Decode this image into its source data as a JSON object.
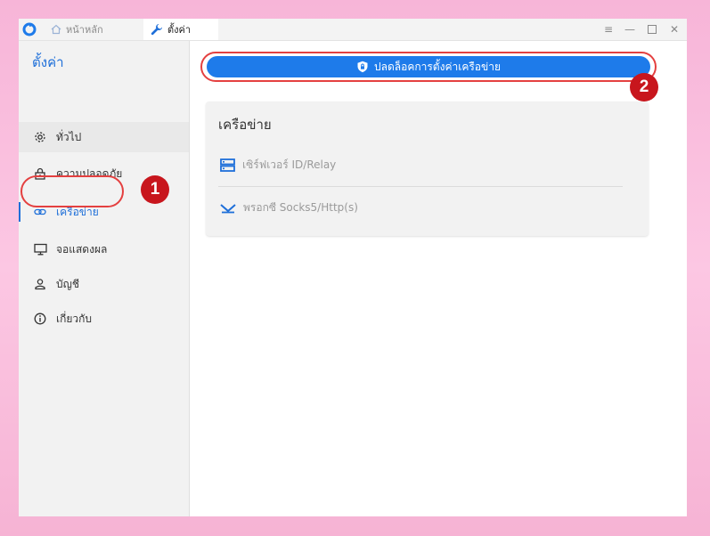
{
  "titlebar": {
    "tabs": [
      {
        "label": "หน้าหลัก",
        "icon": "home-icon"
      },
      {
        "label": "ตั้งค่า",
        "icon": "wrench-icon"
      }
    ],
    "controls": [
      "menu-icon",
      "minimize-icon",
      "maximize-icon",
      "close-icon"
    ]
  },
  "sidebar": {
    "title": "ตั้งค่า",
    "items": [
      {
        "label": "ทั่วไป",
        "icon": "gear-icon"
      },
      {
        "label": "ความปลอดภัย",
        "icon": "lock-icon"
      },
      {
        "label": "เครือข่าย",
        "icon": "link-icon"
      },
      {
        "label": "จอแสดงผล",
        "icon": "monitor-icon"
      },
      {
        "label": "บัญชี",
        "icon": "user-icon"
      },
      {
        "label": "เกี่ยวกับ",
        "icon": "info-icon"
      }
    ]
  },
  "main": {
    "unlock_button": "ปลดล็อคการตั้งค่าเครือข่าย",
    "network_card": {
      "title": "เครือข่าย",
      "rows": [
        {
          "label": "เซิร์ฟเวอร์ ID/Relay",
          "icon": "server-icon"
        },
        {
          "label": "พรอกซี Socks5/Http(s)",
          "icon": "proxy-icon"
        }
      ]
    }
  },
  "annotations": {
    "step1": "1",
    "step2": "2"
  },
  "colors": {
    "accent": "#1e6fd9",
    "button": "#1e7bea",
    "callout": "#c8161d",
    "highlight": "#e44040"
  }
}
